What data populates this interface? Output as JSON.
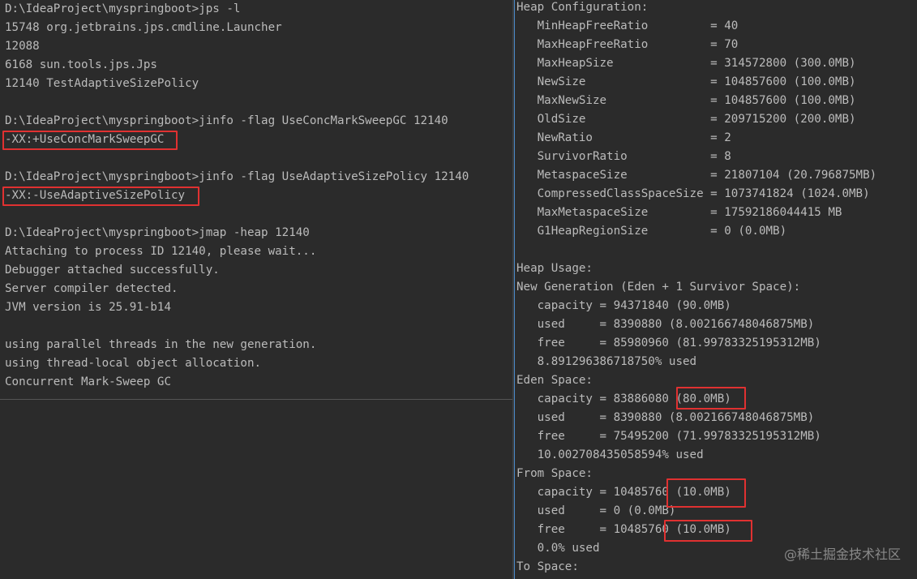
{
  "left_terminal": {
    "lines": [
      "D:\\IdeaProject\\myspringboot>jps -l",
      "15748 org.jetbrains.jps.cmdline.Launcher",
      "12088",
      "6168 sun.tools.jps.Jps",
      "12140 TestAdaptiveSizePolicy",
      "",
      "D:\\IdeaProject\\myspringboot>jinfo -flag UseConcMarkSweepGC 12140",
      "-XX:+UseConcMarkSweepGC",
      "",
      "D:\\IdeaProject\\myspringboot>jinfo -flag UseAdaptiveSizePolicy 12140",
      "-XX:-UseAdaptiveSizePolicy",
      "",
      "D:\\IdeaProject\\myspringboot>jmap -heap 12140",
      "Attaching to process ID 12140, please wait...",
      "Debugger attached successfully.",
      "Server compiler detected.",
      "JVM version is 25.91-b14",
      "",
      "using parallel threads in the new generation.",
      "using thread-local object allocation.",
      "Concurrent Mark-Sweep GC"
    ]
  },
  "right_terminal": {
    "lines": [
      "Heap Configuration:",
      "   MinHeapFreeRatio         = 40",
      "   MaxHeapFreeRatio         = 70",
      "   MaxHeapSize              = 314572800 (300.0MB)",
      "   NewSize                  = 104857600 (100.0MB)",
      "   MaxNewSize               = 104857600 (100.0MB)",
      "   OldSize                  = 209715200 (200.0MB)",
      "   NewRatio                 = 2",
      "   SurvivorRatio            = 8",
      "   MetaspaceSize            = 21807104 (20.796875MB)",
      "   CompressedClassSpaceSize = 1073741824 (1024.0MB)",
      "   MaxMetaspaceSize         = 17592186044415 MB",
      "   G1HeapRegionSize         = 0 (0.0MB)",
      "",
      "Heap Usage:",
      "New Generation (Eden + 1 Survivor Space):",
      "   capacity = 94371840 (90.0MB)",
      "   used     = 8390880 (8.002166748046875MB)",
      "   free     = 85980960 (81.99783325195312MB)",
      "   8.891296386718750% used",
      "Eden Space:",
      "   capacity = 83886080 (80.0MB)",
      "   used     = 8390880 (8.002166748046875MB)",
      "   free     = 75495200 (71.99783325195312MB)",
      "   10.002708435058594% used",
      "From Space:",
      "   capacity = 10485760 (10.0MB)",
      "   used     = 0 (0.0MB)",
      "   free     = 10485760 (10.0MB)",
      "   0.0% used",
      "To Space:"
    ]
  },
  "watermark": "@稀土掘金技术社区",
  "colors": {
    "background": "#2b2b2b",
    "text": "#bbbbbb",
    "highlight": "#e03131",
    "pane_border": "#4a88c7"
  }
}
